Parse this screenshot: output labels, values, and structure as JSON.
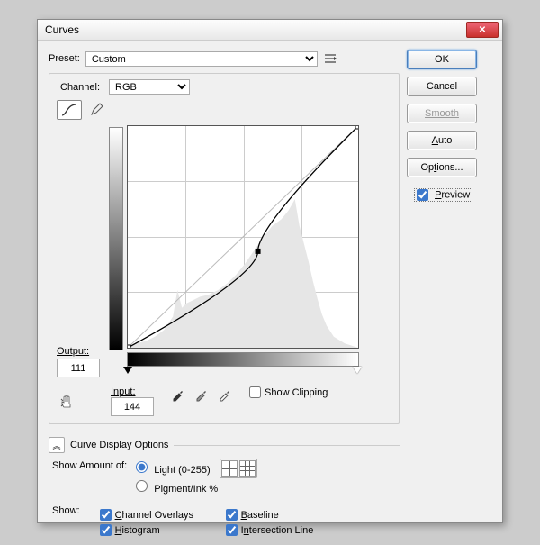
{
  "title": "Curves",
  "side": {
    "ok": "OK",
    "cancel": "Cancel",
    "smooth": "Smooth",
    "auto": "Auto",
    "options": "Options...",
    "preview": "Preview",
    "preview_checked": true
  },
  "preset": {
    "label": "Preset:",
    "value": "Custom"
  },
  "channel": {
    "label": "Channel:",
    "value": "RGB"
  },
  "output": {
    "label": "Output:",
    "value": "111"
  },
  "input": {
    "label": "Input:",
    "value": "144"
  },
  "show_clipping": {
    "label": "Show Clipping",
    "checked": false
  },
  "display_options_header": "Curve Display Options",
  "show_amount": {
    "label": "Show Amount of:",
    "light": "Light  (0-255)",
    "pigment": "Pigment/Ink %",
    "selected": "light"
  },
  "show_label": "Show:",
  "checks": {
    "channel_overlays": {
      "label": "Channel Overlays",
      "checked": true
    },
    "histogram": {
      "label": "Histogram",
      "checked": true
    },
    "baseline": {
      "label": "Baseline",
      "checked": true
    },
    "intersection": {
      "label": "Intersection Line",
      "checked": true
    }
  },
  "chart_data": {
    "type": "line",
    "title": "Curves",
    "xlabel": "Input",
    "ylabel": "Output",
    "xlim": [
      0,
      255
    ],
    "ylim": [
      0,
      255
    ],
    "grid": {
      "vertical_ticks": [
        64,
        128,
        192
      ],
      "horizontal_ticks": [
        64,
        128,
        192
      ]
    },
    "baseline": [
      [
        0,
        0
      ],
      [
        255,
        255
      ]
    ],
    "curve_points": [
      [
        0,
        0
      ],
      [
        144,
        111
      ],
      [
        255,
        255
      ]
    ],
    "histogram_profile": [
      [
        0,
        0.0
      ],
      [
        10,
        0.02
      ],
      [
        20,
        0.03
      ],
      [
        30,
        0.05
      ],
      [
        40,
        0.08
      ],
      [
        50,
        0.14
      ],
      [
        55,
        0.26
      ],
      [
        60,
        0.18
      ],
      [
        65,
        0.2
      ],
      [
        70,
        0.21
      ],
      [
        80,
        0.23
      ],
      [
        90,
        0.24
      ],
      [
        100,
        0.26
      ],
      [
        110,
        0.29
      ],
      [
        120,
        0.33
      ],
      [
        130,
        0.38
      ],
      [
        140,
        0.44
      ],
      [
        150,
        0.5
      ],
      [
        160,
        0.55
      ],
      [
        170,
        0.58
      ],
      [
        178,
        0.62
      ],
      [
        185,
        0.67
      ],
      [
        190,
        0.55
      ],
      [
        195,
        0.47
      ],
      [
        200,
        0.39
      ],
      [
        205,
        0.3
      ],
      [
        210,
        0.22
      ],
      [
        215,
        0.15
      ],
      [
        220,
        0.1
      ],
      [
        228,
        0.05
      ],
      [
        240,
        0.02
      ],
      [
        255,
        0.0
      ]
    ]
  }
}
